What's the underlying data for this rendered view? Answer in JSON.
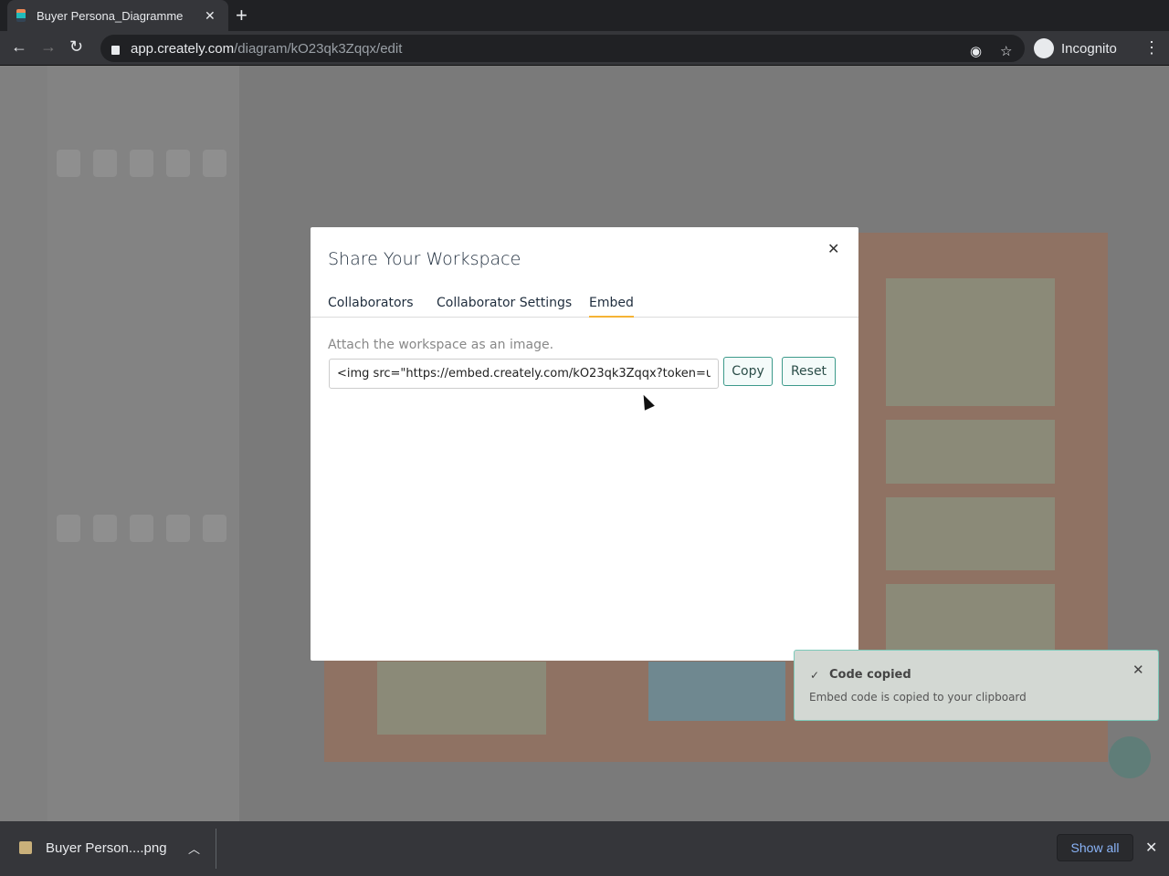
{
  "browser": {
    "tab_title": "Buyer Persona_Diagramme",
    "url_host": "app.creately.com",
    "url_path": "/diagram/kO23qk3Zqqx/edit",
    "profile": "Incognito"
  },
  "modal": {
    "title": "Share Your Workspace",
    "tabs": [
      {
        "label": "Collaborators"
      },
      {
        "label": "Collaborator Settings"
      },
      {
        "label": "Embed",
        "active": true
      }
    ],
    "description": "Attach the workspace as an image.",
    "embed_code": "<img src=\"https://embed.creately.com/kO23qk3Zqqx?token=u",
    "copy_label": "Copy",
    "reset_label": "Reset",
    "accent": "#f5b335"
  },
  "toast": {
    "title": "Code copied",
    "message": "Embed code is copied to your clipboard"
  },
  "downloads": {
    "file": "Buyer Person....png",
    "show_all": "Show all"
  }
}
